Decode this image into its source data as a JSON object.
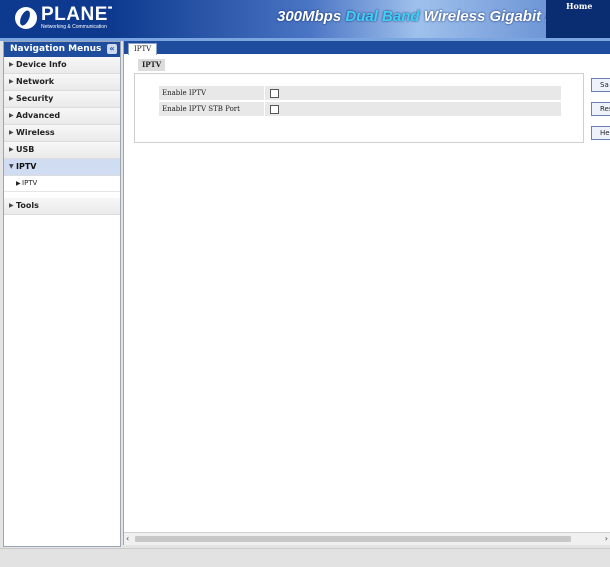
{
  "header": {
    "logo": "PLANET",
    "logo_sub": "Networking & Communication",
    "banner": {
      "prefix": "300Mbps ",
      "highlight": "Dual Band",
      "suffix": " Wireless Gigabit Route"
    },
    "home_label": "Home"
  },
  "sidebar": {
    "title": "Navigation Menus",
    "collapse_icon": "«",
    "items": [
      {
        "label": "Device Info"
      },
      {
        "label": "Network"
      },
      {
        "label": "Security"
      },
      {
        "label": "Advanced"
      },
      {
        "label": "Wireless"
      },
      {
        "label": "USB"
      },
      {
        "label": "IPTV",
        "expanded": true,
        "sub": [
          "IPTV"
        ]
      },
      {
        "label": "Tools"
      }
    ]
  },
  "content": {
    "tab": "IPTV",
    "section_title": "IPTV",
    "fields": [
      {
        "label": "Enable IPTV",
        "checked": false
      },
      {
        "label": "Enable IPTV STB Port",
        "checked": false
      }
    ],
    "buttons": {
      "save": "Sa",
      "reset": "Res",
      "help": "He"
    }
  },
  "colors": {
    "nav_blue": "#1f4d9e",
    "header_blue": "#0d3a8e",
    "active_item": "#d0dcf2"
  }
}
